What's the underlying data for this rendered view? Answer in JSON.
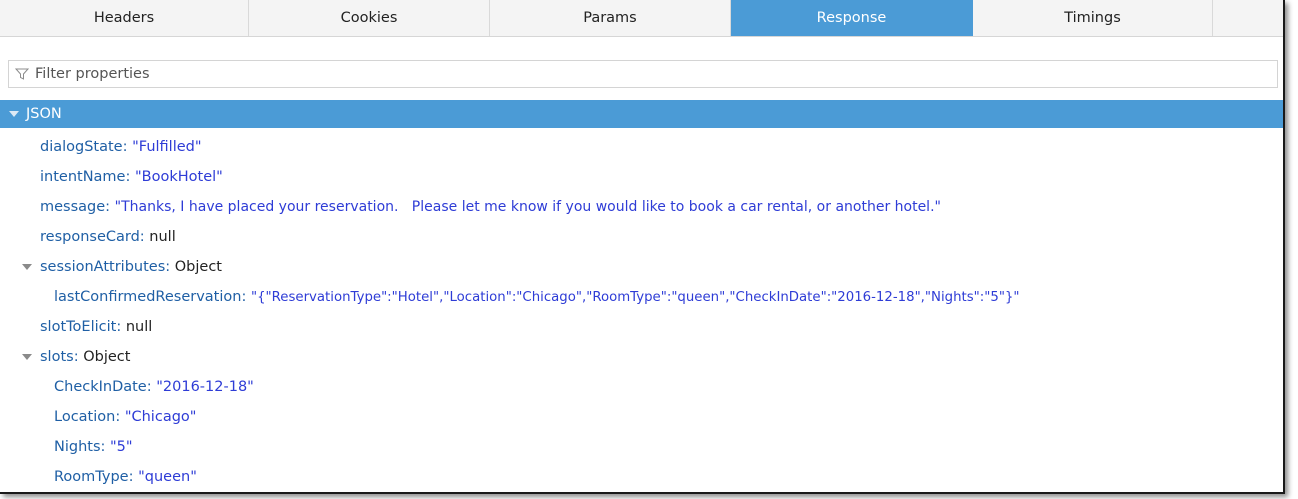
{
  "tabs": [
    {
      "label": "Headers",
      "active": false
    },
    {
      "label": "Cookies",
      "active": false
    },
    {
      "label": "Params",
      "active": false
    },
    {
      "label": "Response",
      "active": true
    },
    {
      "label": "Timings",
      "active": false
    }
  ],
  "filter": {
    "placeholder": "Filter properties"
  },
  "json_section": {
    "label": "JSON"
  },
  "rows": {
    "dialogState": {
      "key": "dialogState",
      "value": "\"Fulfilled\""
    },
    "intentName": {
      "key": "intentName",
      "value": "\"BookHotel\""
    },
    "message": {
      "key": "message",
      "value": "\"Thanks, I have placed your reservation.   Please let me know if you would like to book a car rental, or another hotel.\""
    },
    "responseCard": {
      "key": "responseCard",
      "value": "null"
    },
    "sessionAttributes": {
      "key": "sessionAttributes",
      "value": "Object"
    },
    "lastConfirmedReservation": {
      "key": "lastConfirmedReservation",
      "value": "\"{\"ReservationType\":\"Hotel\",\"Location\":\"Chicago\",\"RoomType\":\"queen\",\"CheckInDate\":\"2016-12-18\",\"Nights\":\"5\"}\""
    },
    "slotToElicit": {
      "key": "slotToElicit",
      "value": "null"
    },
    "slots": {
      "key": "slots",
      "value": "Object"
    },
    "CheckInDate": {
      "key": "CheckInDate",
      "value": "\"2016-12-18\""
    },
    "Location": {
      "key": "Location",
      "value": "\"Chicago\""
    },
    "Nights": {
      "key": "Nights",
      "value": "\"5\""
    },
    "RoomType": {
      "key": "RoomType",
      "value": "\"queen\""
    }
  },
  "colors": {
    "accent": "#4b9bd6",
    "key": "#1f5fa5",
    "string": "#2e3cd6"
  }
}
